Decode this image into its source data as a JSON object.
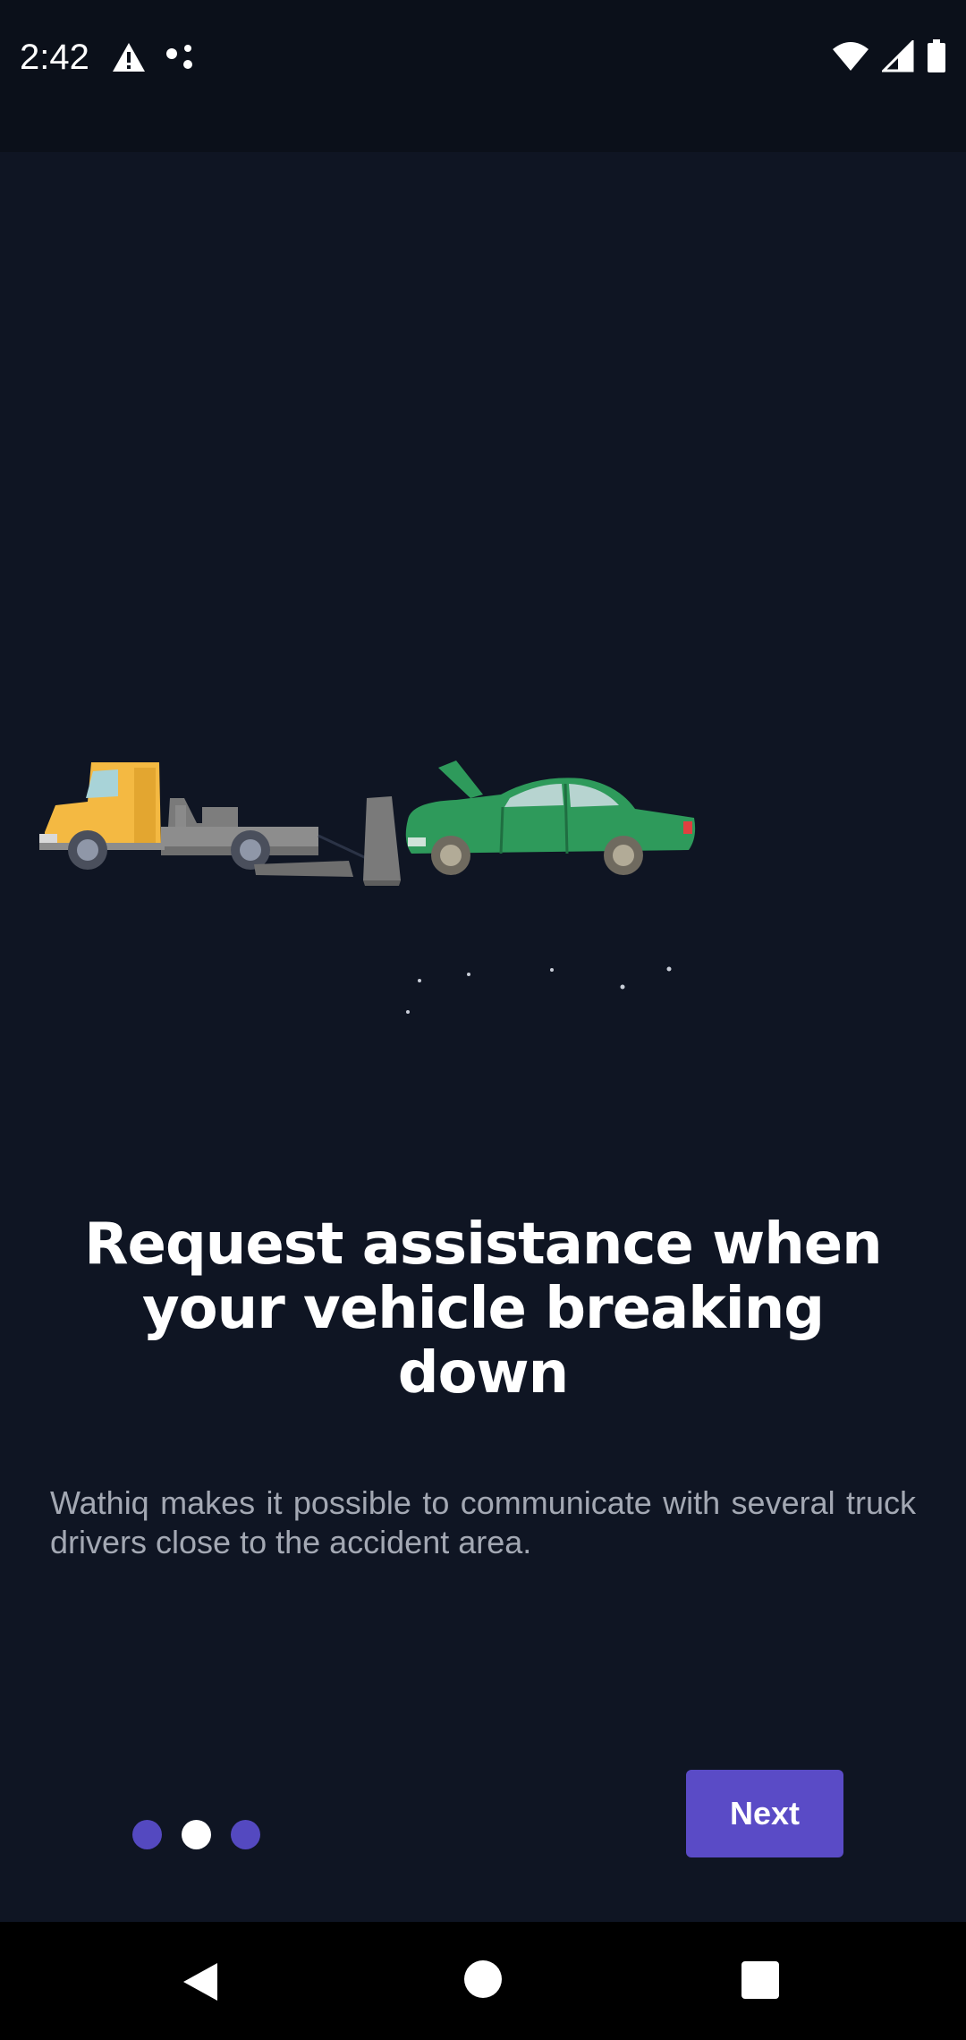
{
  "status_bar": {
    "time": "2:42",
    "icons": [
      "warning-icon",
      "assistant-dots-icon",
      "wifi-icon",
      "cell-signal-icon",
      "battery-icon"
    ]
  },
  "onboarding": {
    "illustration": "tow-truck-and-broken-car",
    "title": "Request assistance when your vehicle breaking down",
    "description": "Wathiq makes it possible to communicate with several truck drivers close to the accident area.",
    "pager": {
      "total": 3,
      "active_index": 1
    },
    "next_label": "Next"
  },
  "colors": {
    "background": "#0f1523",
    "accent": "#5a4bc6",
    "dot_inactive": "#5449c0",
    "dot_active": "#ffffff",
    "truck_yellow": "#f4b942",
    "car_green": "#2e9a5b"
  },
  "nav_bar": {
    "buttons": [
      "back-icon",
      "home-icon",
      "recents-icon"
    ]
  }
}
